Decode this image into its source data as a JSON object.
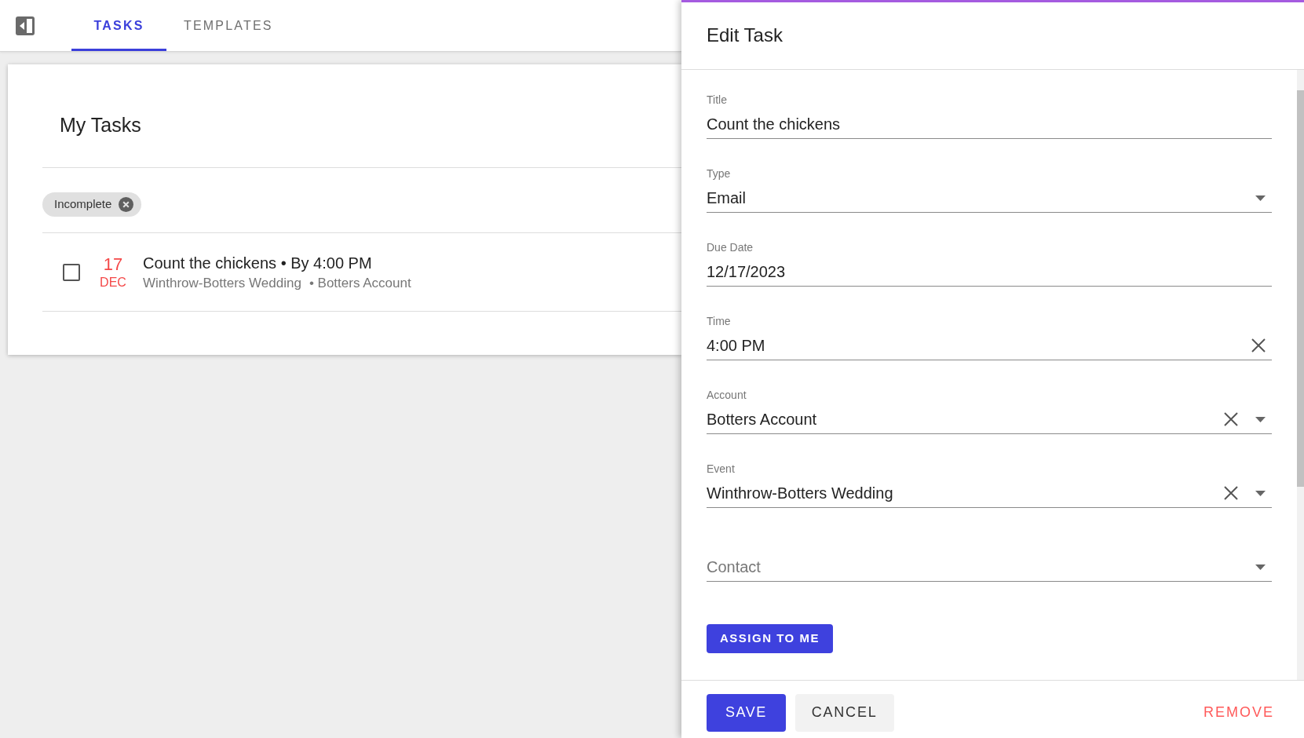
{
  "toolbar": {
    "tabs": [
      {
        "label": "TASKS",
        "selected": true
      },
      {
        "label": "TEMPLATES",
        "selected": false
      }
    ]
  },
  "task_list": {
    "title": "My Tasks",
    "filters": [
      {
        "label": "Incomplete"
      }
    ],
    "tasks": [
      {
        "checked": false,
        "overdue": true,
        "day": "17",
        "month": "DEC",
        "title": "Count the chickens • By 4:00 PM",
        "event": "Winthrow-Botters Wedding",
        "account": "• Botters Account"
      }
    ]
  },
  "edit_panel": {
    "title": "Edit Task",
    "fields": [
      {
        "kind": "text",
        "label": "Title",
        "value": "Count the chickens",
        "clearable": false
      },
      {
        "kind": "select",
        "label": "Type",
        "value": "Email",
        "clearable": false
      },
      {
        "kind": "text",
        "label": "Due Date",
        "value": "12/17/2023",
        "clearable": false
      },
      {
        "kind": "text",
        "label": "Time",
        "value": "4:00 PM",
        "clearable": true
      },
      {
        "kind": "select",
        "label": "Account",
        "value": "Botters Account",
        "clearable": true
      },
      {
        "kind": "select",
        "label": "Event",
        "value": "Winthrow-Botters Wedding",
        "clearable": true
      },
      {
        "kind": "select",
        "placeholder": "Contact",
        "clearable": false
      }
    ],
    "assign_button": "ASSIGN TO ME",
    "footer": {
      "save": "SAVE",
      "cancel": "CANCEL",
      "remove": "REMOVE"
    }
  }
}
